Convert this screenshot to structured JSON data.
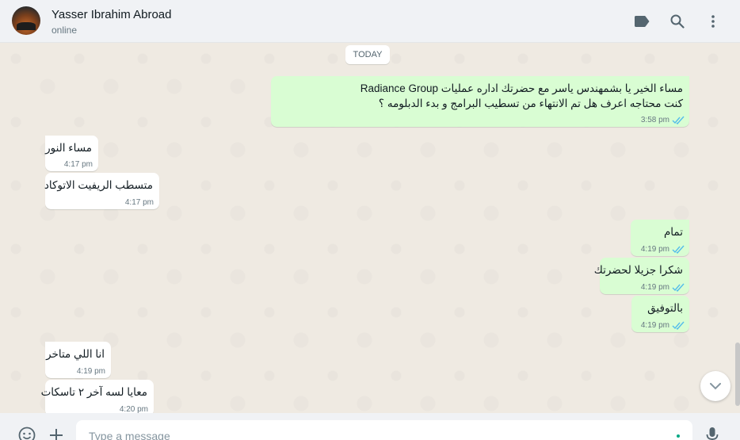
{
  "header": {
    "contact_name": "Yasser Ibrahim Abroad",
    "status": "online"
  },
  "chat": {
    "date_label": "TODAY",
    "messages": [
      {
        "direction": "out",
        "lines": [
          "مساء الخير يا بشمهندس ياسر مع حضرتك اداره عمليات Radiance Group",
          "كنت محتاجه اعرف هل تم الانتهاء من تسطيب البرامج و بدء الدبلومه  ؟"
        ],
        "time": "3:58 pm",
        "status": "read"
      },
      {
        "direction": "in",
        "lines": [
          "مساء النور"
        ],
        "time": "4:17 pm"
      },
      {
        "direction": "in",
        "lines": [
          "متسطب الريفيت الاتوكاد"
        ],
        "time": "4:17 pm"
      },
      {
        "direction": "out",
        "lines": [
          "تمام"
        ],
        "time": "4:19 pm",
        "status": "read"
      },
      {
        "direction": "out",
        "lines": [
          "شكرا جزيلا لحضرتك"
        ],
        "time": "4:19 pm",
        "status": "read"
      },
      {
        "direction": "out",
        "lines": [
          "بالتوفيق"
        ],
        "time": "4:19 pm",
        "status": "read"
      },
      {
        "direction": "in",
        "lines": [
          "انا اللي متاخر"
        ],
        "time": "4:19 pm"
      },
      {
        "direction": "in",
        "lines": [
          "معايا لسه آخر ٢ تاسكات"
        ],
        "time": "4:20 pm"
      }
    ]
  },
  "composer": {
    "placeholder": "Type a message"
  },
  "icons": {
    "labels": "label-icon",
    "search": "search-icon",
    "menu": "menu-icon",
    "emoji": "emoji-icon",
    "attach": "attach-icon",
    "mic": "mic-icon",
    "scroll_down": "chevron-down-icon",
    "ticks": "double-check-icon"
  },
  "colors": {
    "outgoing_bubble": "#d9fdd3",
    "incoming_bubble": "#ffffff",
    "read_tick": "#53bdeb",
    "chat_background": "#efeae2",
    "header_background": "#f0f2f5"
  }
}
